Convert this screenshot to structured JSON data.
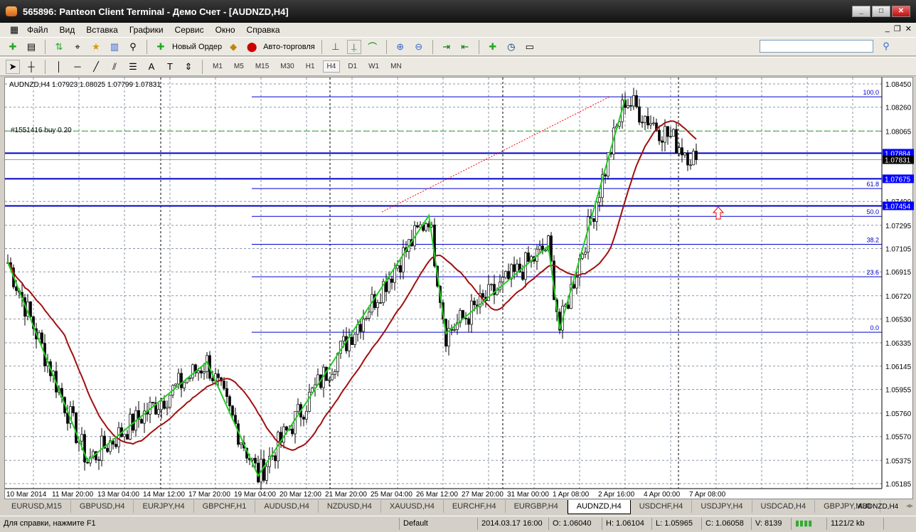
{
  "window": {
    "title": "565896: Panteon Client Terminal - Демо Счет - [AUDNZD,H4]"
  },
  "menu": [
    "Файл",
    "Вид",
    "Вставка",
    "Графики",
    "Сервис",
    "Окно",
    "Справка"
  ],
  "toolbar": {
    "new_order": "Новый Ордер",
    "auto_trading": "Авто-торговля"
  },
  "timeframes": [
    "M1",
    "M5",
    "M15",
    "M30",
    "H1",
    "H4",
    "D1",
    "W1",
    "MN"
  ],
  "active_timeframe": "H4",
  "chart": {
    "header": "AUDNZD,H4  1.07923 1.08025 1.07799 1.07831",
    "order_label": "#1551416 buy 0.20",
    "price_max": 1.0845,
    "price_min": 1.05185,
    "price_labels": [
      "1.08450",
      "1.08260",
      "1.08065",
      "1.07490",
      "1.07295",
      "1.07105",
      "1.06915",
      "1.06720",
      "1.06530",
      "1.06335",
      "1.06145",
      "1.05955",
      "1.05760",
      "1.05570",
      "1.05375",
      "1.05185"
    ],
    "price_label_values": [
      1.0845,
      1.0826,
      1.08065,
      1.0749,
      1.07295,
      1.07105,
      1.06915,
      1.0672,
      1.0653,
      1.06335,
      1.06145,
      1.05955,
      1.0576,
      1.0557,
      1.05375,
      1.05185
    ],
    "hlines": [
      {
        "label": "1.07884",
        "price": 1.07884
      },
      {
        "label": "1.07675",
        "price": 1.07675
      },
      {
        "label": "1.07454",
        "price": 1.07454
      }
    ],
    "bid": {
      "label": "1.07831",
      "price": 1.07831
    },
    "order_price": 1.08065,
    "fib_levels": [
      {
        "label": "100.0",
        "price": 1.08345
      },
      {
        "label": "61.8",
        "price": 1.07595
      },
      {
        "label": "50.0",
        "price": 1.07368
      },
      {
        "label": "38.2",
        "price": 1.0714
      },
      {
        "label": "23.6",
        "price": 1.06875
      },
      {
        "label": "0.0",
        "price": 1.06422
      }
    ],
    "time_labels": [
      "10 Mar 2014",
      "11 Mar 20:00",
      "13 Mar 04:00",
      "14 Mar 12:00",
      "17 Mar 20:00",
      "19 Mar 04:00",
      "20 Mar 12:00",
      "21 Mar 20:00",
      "25 Mar 04:00",
      "26 Mar 12:00",
      "27 Mar 20:00",
      "31 Mar 00:00",
      "1 Apr 08:00",
      "2 Apr 16:00",
      "4 Apr 00:00",
      "7 Apr 08:00"
    ],
    "zigzag": [
      [
        0,
        1.06992
      ],
      [
        28,
        1.05371
      ],
      [
        70,
        1.06178
      ],
      [
        88,
        1.05249
      ],
      [
        148,
        1.07375
      ],
      [
        154,
        1.06411
      ],
      [
        190,
        1.07125
      ],
      [
        194,
        1.06446
      ],
      [
        217,
        1.08328
      ],
      [
        242,
        1.07831
      ]
    ],
    "colors": {
      "bull": "#ffffff",
      "bear": "#000000",
      "ma": "#a01010",
      "zigzag": "#22cc22",
      "level": "#0000cc",
      "order": "#22aa22",
      "trend": "#ff0000"
    }
  },
  "tabs": [
    "EURUSD,M15",
    "GBPUSD,H4",
    "EURJPY,H4",
    "GBPCHF,H1",
    "AUDUSD,H4",
    "NZDUSD,H4",
    "XAUUSD,H4",
    "EURCHF,H4",
    "EURGBP,H4",
    "AUDNZD,H4",
    "USDCHF,H4",
    "USDJPY,H4",
    "USDCAD,H4",
    "GBPJPY,M30"
  ],
  "active_tab": "AUDNZD,H4",
  "status": {
    "help": "Для справки, нажмите F1",
    "profile": "Default",
    "time": "2014.03.17 16:00",
    "open": "O: 1.06040",
    "high": "H: 1.06104",
    "low": "L: 1.05965",
    "close": "C: 1.06058",
    "volume": "V: 8139",
    "traffic": "1121/2 kb"
  }
}
